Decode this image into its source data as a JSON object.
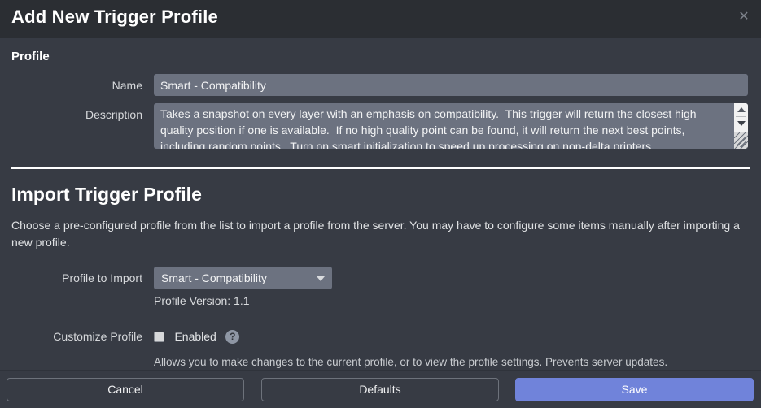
{
  "header": {
    "title": "Add New Trigger Profile",
    "close_label": "✕"
  },
  "profile_section": {
    "heading": "Profile",
    "name_label": "Name",
    "name_value": "Smart - Compatibility",
    "name_placeholder": "",
    "description_label": "Description",
    "description_value": "Takes a snapshot on every layer with an emphasis on compatibility.  This trigger will return the closest high quality position if one is available.  If no high quality point can be found, it will return the next best points, including random points.  Turn on smart initialization to speed up processing on non-delta printers.",
    "description_placeholder": ""
  },
  "import_section": {
    "heading": "Import Trigger Profile",
    "intro": "Choose a pre-configured profile from the list to import a profile from the server. You may have to configure some items manually after importing a new profile.",
    "profile_to_import_label": "Profile to Import",
    "profile_to_import_value": "Smart - Compatibility",
    "profile_version_text": "Profile Version: 1.1",
    "customize_label": "Customize Profile",
    "enabled_label": "Enabled",
    "enabled_checked": false,
    "help_glyph": "?",
    "hint": "Allows you to make changes to the current profile, or to view the profile settings. Prevents server updates."
  },
  "footer": {
    "cancel_label": "Cancel",
    "defaults_label": "Defaults",
    "save_label": "Save"
  },
  "colors": {
    "header_bg": "#2b2e33",
    "body_bg": "#373b44",
    "field_bg": "#6c7280",
    "primary": "#7083da",
    "divider": "#ffffff"
  }
}
